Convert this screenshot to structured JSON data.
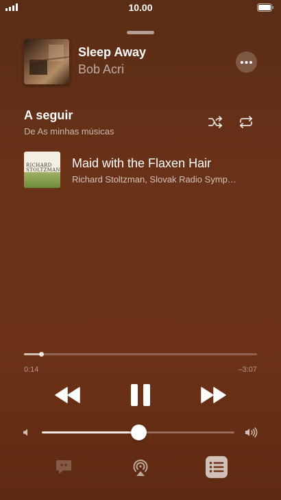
{
  "status_bar": {
    "time": "10.00"
  },
  "now_playing": {
    "title": "Sleep Away",
    "artist": "Bob Acri",
    "artwork_icon": "album-artwork"
  },
  "up_next": {
    "heading": "A seguir",
    "source": "De As minhas músicas",
    "items": [
      {
        "title": "Maid with the Flaxen Hair",
        "artist": "Richard Stoltzman, Slovak Radio Symp…",
        "art_text": "RICHARD STOLTZMAN"
      }
    ]
  },
  "playback": {
    "elapsed": "0:14",
    "remaining": "–3:07",
    "progress_fraction": 0.074,
    "volume_fraction": 0.5
  },
  "icons": {
    "more": "ellipsis-icon",
    "shuffle": "shuffle-icon",
    "repeat": "repeat-icon",
    "rewind": "rewind-icon",
    "pause": "pause-icon",
    "forward": "fast-forward-icon",
    "lyrics": "lyrics-quote-icon",
    "airplay": "airplay-icon",
    "queue": "queue-list-icon"
  },
  "colors": {
    "background": "#6b3218",
    "accent": "#ffffff"
  }
}
